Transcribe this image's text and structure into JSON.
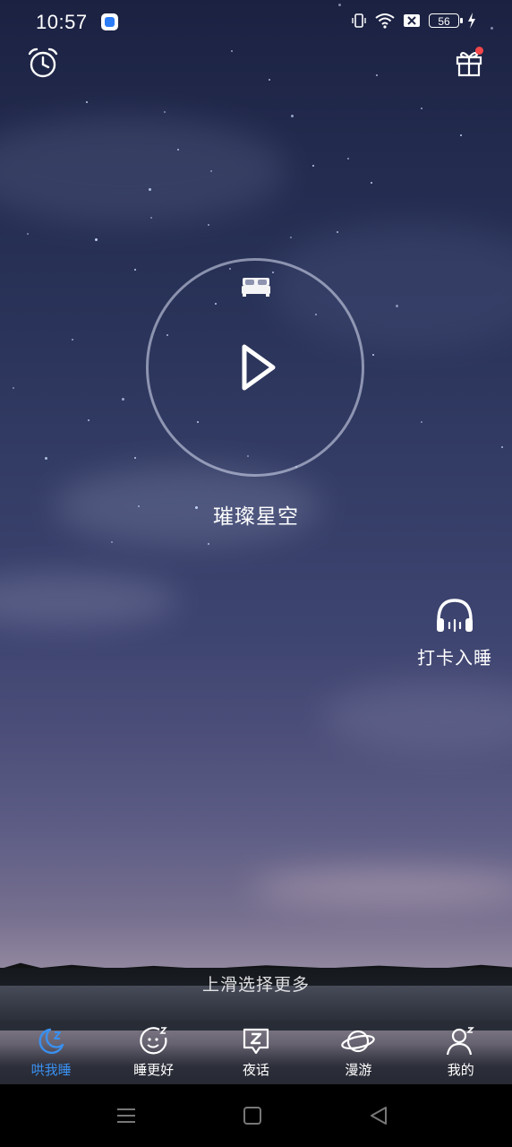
{
  "status_bar": {
    "time": "10:57",
    "battery_level": "56"
  },
  "icons": {
    "alarm": "alarm-clock-icon",
    "gift": "gift-icon",
    "bed": "bed-icon",
    "play": "play-icon",
    "headphones": "headphones-icon"
  },
  "player": {
    "track_title": "璀璨星空"
  },
  "checkin": {
    "label": "打卡入睡"
  },
  "swipe_hint": "上滑选择更多",
  "tabs": [
    {
      "label": "哄我睡",
      "icon": "moon-z-icon",
      "active": true
    },
    {
      "label": "睡更好",
      "icon": "smile-z-icon",
      "active": false
    },
    {
      "label": "夜话",
      "icon": "chat-z-icon",
      "active": false
    },
    {
      "label": "漫游",
      "icon": "planet-icon",
      "active": false
    },
    {
      "label": "我的",
      "icon": "user-z-icon",
      "active": false
    }
  ],
  "colors": {
    "accent": "#3a90ef",
    "notification_dot": "#f2464a",
    "sky_top": "#1b2141",
    "horizon": "#b7abba"
  },
  "system_nav": [
    "menu-icon",
    "home-icon",
    "back-icon"
  ]
}
